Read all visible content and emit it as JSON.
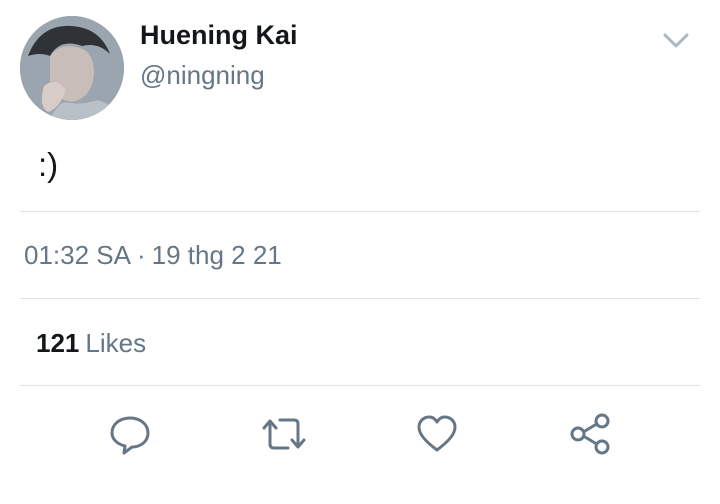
{
  "tweet": {
    "author": {
      "display_name": "Huening Kai",
      "handle": "@ningning"
    },
    "text": ":)",
    "time": "01:32 SA",
    "separator": "·",
    "date": "19 thg 2 21",
    "likes": {
      "count": "121",
      "label": "Likes"
    }
  },
  "icons": {
    "menu": "chevron-down-icon",
    "reply": "reply-icon",
    "retweet": "retweet-icon",
    "like": "heart-icon",
    "share": "share-icon"
  },
  "colors": {
    "text": "#14171a",
    "secondary": "#657786",
    "icon": "#657786",
    "divider": "#dfe3e7",
    "chevron": "#aab8c2"
  }
}
